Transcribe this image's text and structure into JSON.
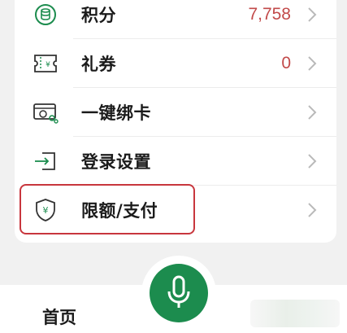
{
  "menu": {
    "items": [
      {
        "label": "积分",
        "value": "7,758",
        "icon": "coin-stack-icon"
      },
      {
        "label": "礼券",
        "value": "0",
        "icon": "voucher-icon"
      },
      {
        "label": "一键绑卡",
        "value": "",
        "icon": "card-link-icon"
      },
      {
        "label": "登录设置",
        "value": "",
        "icon": "login-arrow-icon"
      },
      {
        "label": "限额/支付",
        "value": "",
        "icon": "shield-yuan-icon"
      }
    ]
  },
  "bottom_nav": {
    "home_label": "首页",
    "voice_icon": "microphone-icon"
  },
  "colors": {
    "accent": "#1c8c4e",
    "value_red": "#c24a4a",
    "highlight_border": "#c8363d"
  }
}
